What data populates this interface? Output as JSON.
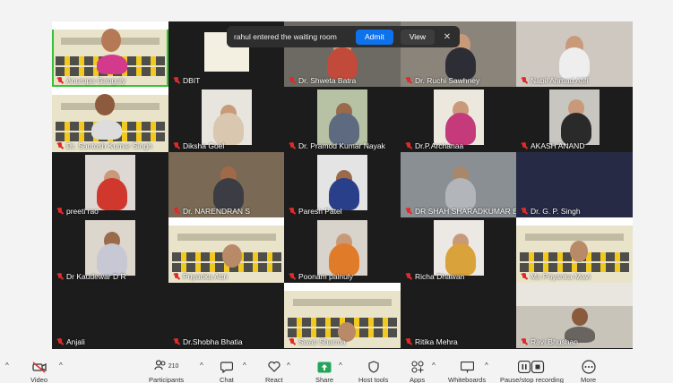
{
  "waiting_room": {
    "message": "rahul entered the waiting room",
    "admit_label": "Admit",
    "view_label": "View",
    "close_glyph": "✕"
  },
  "participants": [
    {
      "name": "Anurupa Ganguly"
    },
    {
      "name": "DBIT"
    },
    {
      "name": "Dr. Shweta Batra"
    },
    {
      "name": "Dr. Ruchi Sawhney"
    },
    {
      "name": "Nabil Ahmad Afifi"
    },
    {
      "name": "Dr. Santosh Kumar Singh"
    },
    {
      "name": "Diksha Goel"
    },
    {
      "name": "Dr. Pramod Kumar Nayak"
    },
    {
      "name": "Dr.P.Archanaa"
    },
    {
      "name": "AKASH ANAND"
    },
    {
      "name": "preeti rao"
    },
    {
      "name": "Dr. NARENDRAN S"
    },
    {
      "name": "Paresh Patel"
    },
    {
      "name": "DR SHAH SHARADKUMAR BA..."
    },
    {
      "name": "Dr. G. P. Singh"
    },
    {
      "name": "Dr Kaudewar D R"
    },
    {
      "name": "Priyanka Attri"
    },
    {
      "name": "Poonam painuly"
    },
    {
      "name": "Richa Dhawan"
    },
    {
      "name": "Ms Priyanka Mavi"
    },
    {
      "name": "Anjali"
    },
    {
      "name": "Dr.Shobha Bhatia"
    },
    {
      "name": "Swati Sharma"
    },
    {
      "name": "Ritika Mehra"
    },
    {
      "name": "Ravi Bhushan"
    }
  ],
  "toolbar": {
    "video_label": "Video",
    "participants_label": "Participants",
    "participants_count": "210",
    "chat_label": "Chat",
    "react_label": "React",
    "share_label": "Share",
    "host_tools_label": "Host tools",
    "apps_label": "Apps",
    "whiteboards_label": "Whiteboards",
    "recording_label": "Pause/stop recording",
    "more_label": "More"
  },
  "colors": {
    "muted": "#e02a2a",
    "admit": "#0e72ed",
    "share": "#23a55a",
    "active_speaker": "#35c435"
  }
}
